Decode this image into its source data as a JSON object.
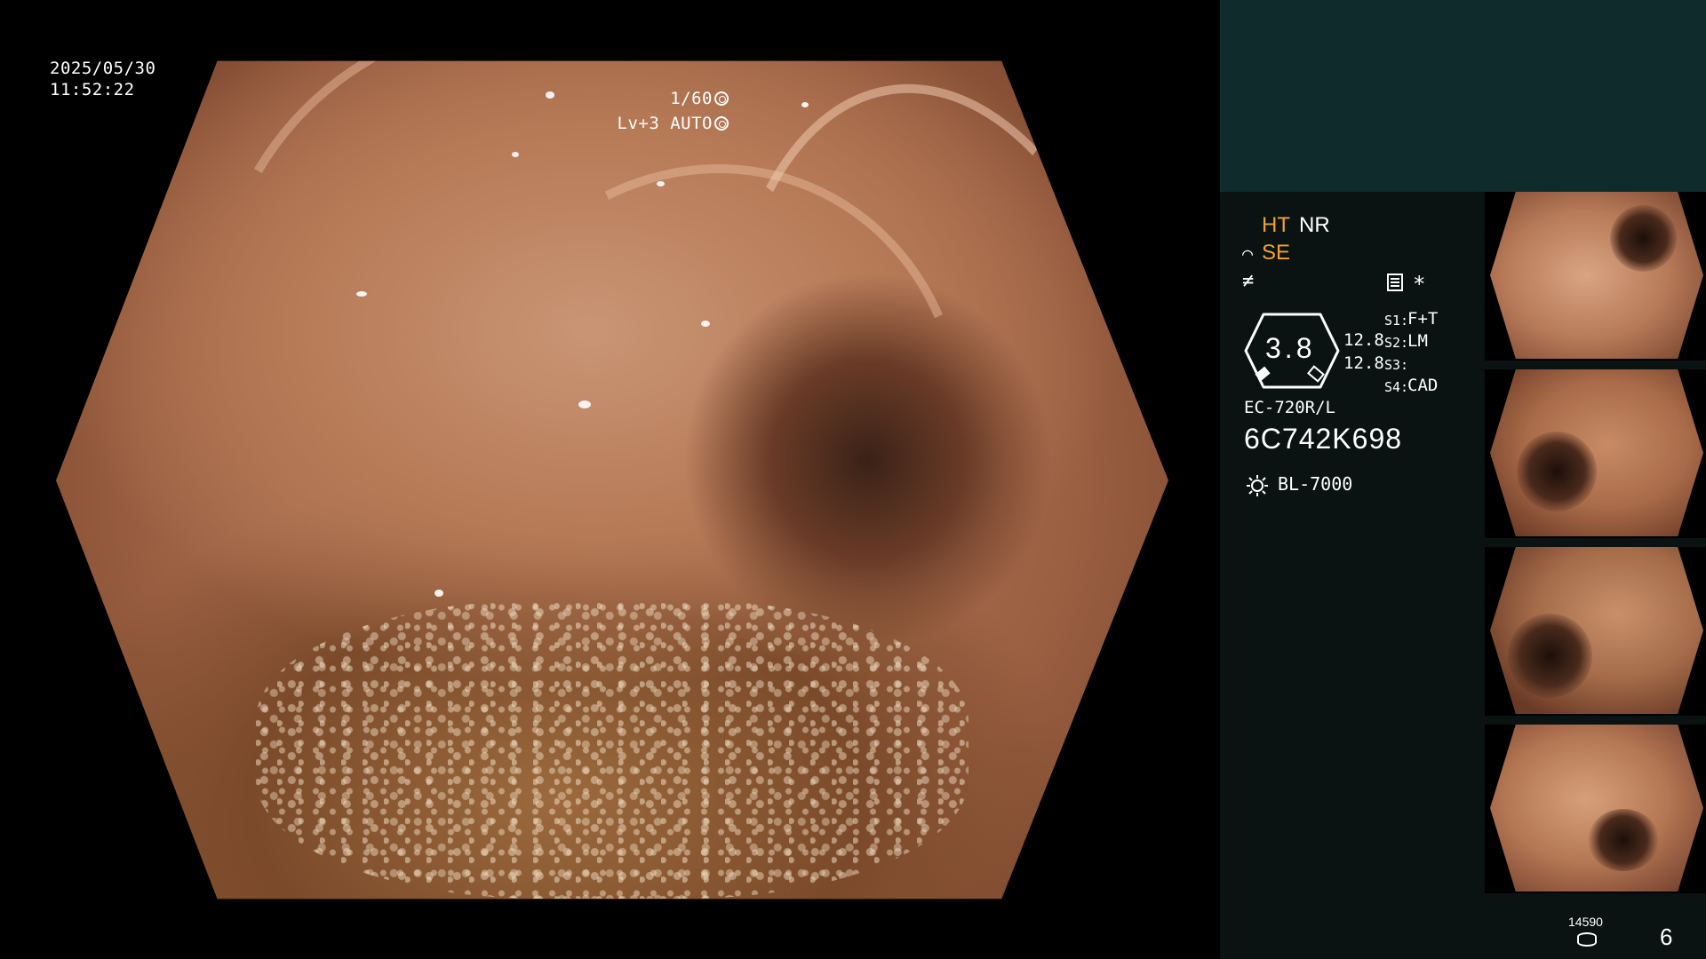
{
  "overlay": {
    "date": "2025/05/30",
    "time": "11:52:22",
    "shutter": "1/60",
    "level": "Lv+3 AUTO"
  },
  "info_panel": {
    "ht": "HT",
    "nr": "NR",
    "se": "SE",
    "gauge_value": "3.8",
    "value_a": "12.8",
    "value_b": "12.8",
    "slots": [
      {
        "label": "S1:",
        "value": "F+T"
      },
      {
        "label": "S2:",
        "value": "LM"
      },
      {
        "label": "S3:",
        "value": ""
      },
      {
        "label": "S4:",
        "value": "CAD"
      }
    ],
    "model": "EC-720R/L",
    "serial": "6C742K698",
    "light_source": "BL-7000"
  },
  "footer": {
    "counter": "14590",
    "page": "6"
  },
  "icons": {
    "shutter_icon": "aperture-icon",
    "auto_icon": "iris-icon",
    "se_symbol": "scope-symbol-icon",
    "ne_symbol": "slash-symbol-icon",
    "doc": "document-icon",
    "light": "sun-icon",
    "db": "database-icon"
  },
  "colors": {
    "accent_orange": "#f0a030",
    "panel_bg": "#0a1312",
    "panel_top": "#0f2b2b"
  }
}
